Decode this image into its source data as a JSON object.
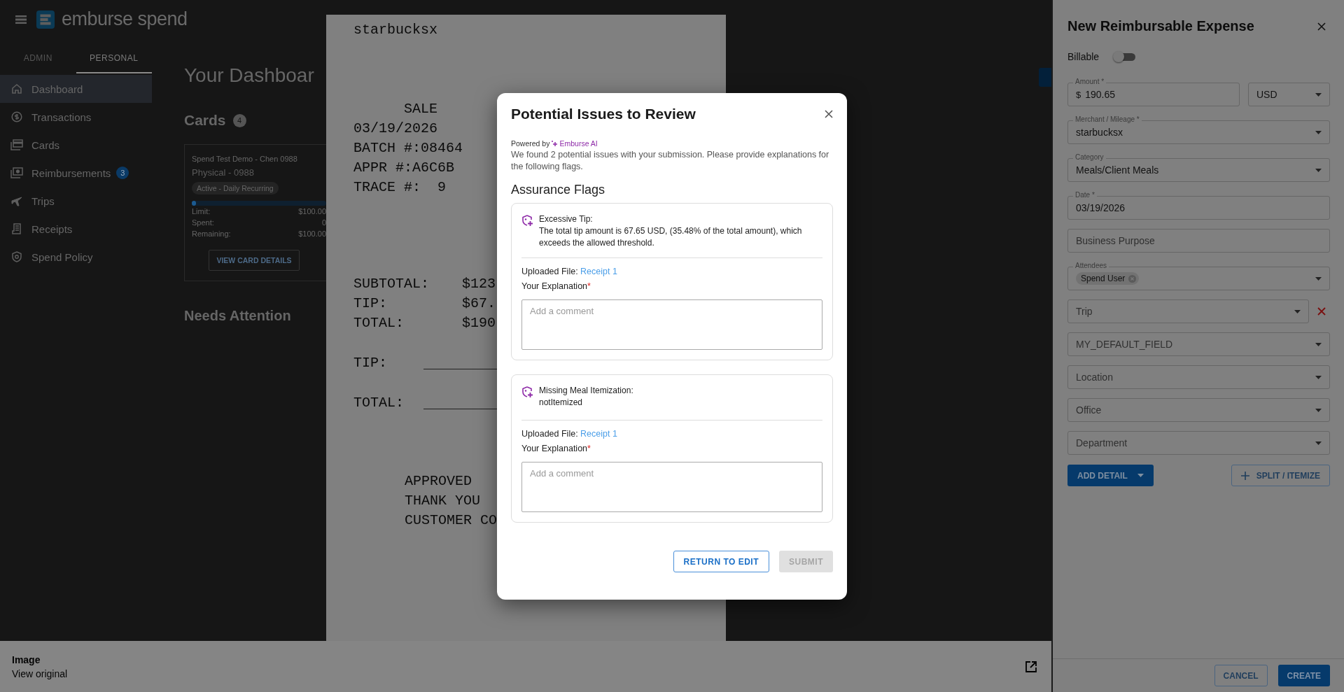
{
  "app": {
    "logo_text": "emburse spend",
    "tabs": [
      {
        "label": "ADMIN",
        "selected": false
      },
      {
        "label": "PERSONAL",
        "selected": true
      }
    ],
    "nav": [
      {
        "label": "Dashboard",
        "selected": true
      },
      {
        "label": "Transactions",
        "selected": false
      },
      {
        "label": "Cards",
        "selected": false
      },
      {
        "label": "Reimbursements",
        "selected": false,
        "badge": "3"
      },
      {
        "label": "Trips",
        "selected": false
      },
      {
        "label": "Receipts",
        "selected": false
      },
      {
        "label": "Spend Policy",
        "selected": false
      }
    ]
  },
  "dashboard": {
    "title": "Your Dashboar",
    "cards_heading": "Cards",
    "cards_count": "4",
    "card": {
      "name": "Spend Test Demo - Chen 0988",
      "type": "Physical - 0988",
      "status": "Active - Daily Recurring",
      "level": 0.03,
      "rows": [
        {
          "label": "Limit:",
          "value": "$100.00"
        },
        {
          "label": "Spent:",
          "value": "0"
        },
        {
          "label": "Remaining:",
          "value": "$100.00"
        }
      ],
      "button": "VIEW CARD DETAILS"
    },
    "needs_attention": "Needs Attention"
  },
  "receipt": {
    "merchant": "starbucksx",
    "title": "SALE",
    "header_lines": [
      "03/19/2026",
      "BATCH #:08464",
      "APPR #:A6C6B",
      "TRACE #:  9"
    ],
    "totals": [
      {
        "label": "SUBTOTAL:",
        "value": "$123"
      },
      {
        "label": "TIP:",
        "value": "$67."
      },
      {
        "label": "TOTAL:",
        "value": "$190"
      }
    ],
    "signature_lines": [
      "TIP:",
      "TOTAL:"
    ],
    "footer_lines": [
      "APPROVED",
      "THANK YOU",
      "CUSTOMER CO"
    ]
  },
  "image_bar": {
    "title": "Image",
    "link": "View original"
  },
  "modal": {
    "title": "Potential Issues to Review",
    "powered_by": "Powered by",
    "ai_name": "Emburse AI",
    "description": "We found 2 potential issues with your submission. Please provide explanations for the following flags.",
    "section_title": "Assurance Flags",
    "flags": [
      {
        "title": "Excessive Tip:",
        "description": "The total tip amount is 67.65 USD, (35.48% of the total amount), which exceeds the allowed threshold.",
        "file_label": "Uploaded File:",
        "file_link": "Receipt 1",
        "explanation_label": "Your Explanation",
        "required_mark": "*",
        "placeholder": "Add a comment"
      },
      {
        "title": "Missing Meal Itemization:",
        "description": "notItemized",
        "file_label": "Uploaded File:",
        "file_link": "Receipt 1",
        "explanation_label": "Your Explanation",
        "required_mark": "*",
        "placeholder": "Add a comment"
      }
    ],
    "buttons": [
      {
        "label": "RETURN TO EDIT",
        "kind": "outlined",
        "disabled": false
      },
      {
        "label": "SUBMIT",
        "kind": "filled",
        "disabled": true
      }
    ]
  },
  "panel": {
    "title": "New Reimbursable Expense",
    "billable": {
      "label": "Billable",
      "on": false
    },
    "fields": [
      {
        "kind": "amount",
        "label": "Amount *",
        "prefix": "$",
        "value": "190.65",
        "currency": "USD",
        "removable": false
      },
      {
        "kind": "select",
        "label": "Merchant / Mileage *",
        "value": "starbucksx",
        "removable": false
      },
      {
        "kind": "select",
        "label": "Category",
        "value": "Meals/Client Meals",
        "removable": false
      },
      {
        "kind": "input",
        "label": "Date *",
        "value": "03/19/2026",
        "removable": false
      },
      {
        "kind": "input",
        "placeholder": "Business Purpose",
        "removable": false
      },
      {
        "kind": "chips",
        "label": "Attendees",
        "chips": [
          "Spend User"
        ],
        "removable": false
      },
      {
        "kind": "select",
        "placeholder": "Trip",
        "removable": true
      },
      {
        "kind": "select",
        "placeholder": "MY_DEFAULT_FIELD",
        "removable": false
      },
      {
        "kind": "select",
        "placeholder": "Location",
        "removable": false
      },
      {
        "kind": "select",
        "placeholder": "Office",
        "removable": false
      },
      {
        "kind": "select",
        "placeholder": "Department",
        "removable": false
      }
    ],
    "add_detail": "ADD DETAIL",
    "split": "SPLIT / ITEMIZE",
    "footer_buttons": [
      {
        "label": "CANCEL",
        "kind": "outlined"
      },
      {
        "label": "CREATE",
        "kind": "filled"
      }
    ]
  }
}
